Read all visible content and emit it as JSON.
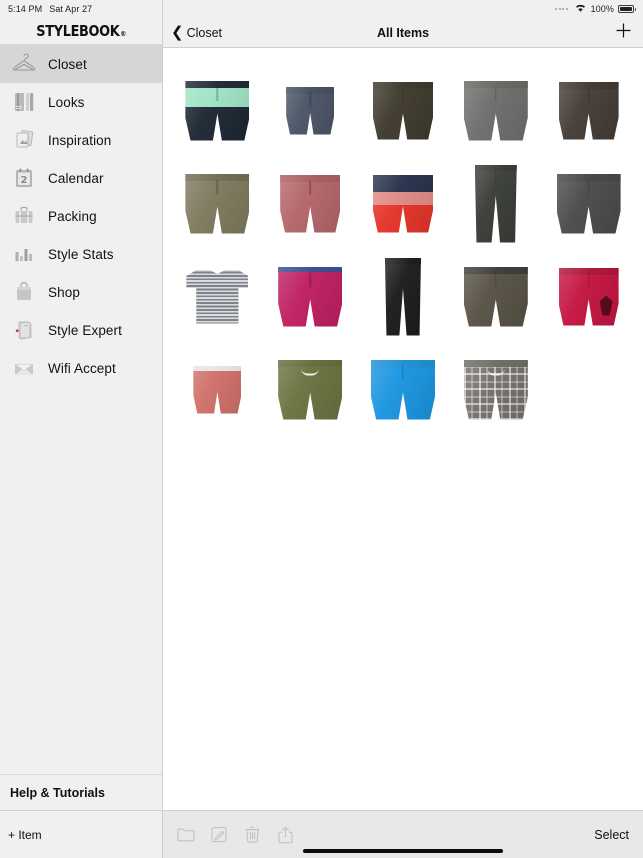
{
  "status_bar": {
    "time": "5:14 PM",
    "date": "Sat Apr 27",
    "battery_percent": "100%",
    "wifi_icon": "wifi-icon",
    "battery_icon": "battery-icon"
  },
  "brand": {
    "name": "STYLEBOOK",
    "registered_mark": "®"
  },
  "sidebar": {
    "items": [
      {
        "label": "Closet",
        "icon": "hanger-icon",
        "selected": true
      },
      {
        "label": "Looks",
        "icon": "outfit-icon",
        "selected": false
      },
      {
        "label": "Inspiration",
        "icon": "photos-icon",
        "selected": false
      },
      {
        "label": "Calendar",
        "icon": "calendar-icon",
        "selected": false
      },
      {
        "label": "Packing",
        "icon": "suitcase-icon",
        "selected": false
      },
      {
        "label": "Style Stats",
        "icon": "bar-chart-icon",
        "selected": false
      },
      {
        "label": "Shop",
        "icon": "shopping-bag-icon",
        "selected": false
      },
      {
        "label": "Style Expert",
        "icon": "book-star-icon",
        "selected": false
      },
      {
        "label": "Wifi Accept",
        "icon": "envelope-icon",
        "selected": false
      }
    ],
    "calendar_day": "2",
    "help_label": "Help & Tutorials",
    "add_item_label": "+ Item"
  },
  "navbar": {
    "back_label": "Closet",
    "back_icon": "chevron-left-icon",
    "title": "All Items",
    "add_icon": "plus-icon"
  },
  "grid": {
    "columns": 5,
    "items": [
      {
        "name": "mint-navy-colorblock-boardshorts",
        "type": "shorts",
        "body": "#9fe3c6",
        "band": "#1d2733",
        "block_bottom": "#1d2733",
        "variant": "wide"
      },
      {
        "name": "navy-chino-shorts",
        "type": "shorts",
        "body": "#4b5566",
        "band": "#434d5d",
        "variant": "narrow"
      },
      {
        "name": "dark-olive-shorts",
        "type": "shorts",
        "body": "#3f3a2d",
        "band": "#3a3529",
        "variant": "normal"
      },
      {
        "name": "grey-chino-shorts",
        "type": "shorts",
        "body": "#6e6e6c",
        "band": "#66665f",
        "variant": "wide"
      },
      {
        "name": "dark-brown-shorts",
        "type": "shorts",
        "body": "#453c36",
        "band": "#3e362f",
        "variant": "normal"
      },
      {
        "name": "khaki-olive-shorts",
        "type": "shorts",
        "body": "#7e7a5e",
        "band": "#6f6b52",
        "variant": "wide"
      },
      {
        "name": "dusty-rose-shorts",
        "type": "shorts",
        "body": "#b5666a",
        "band": "#a85c60",
        "variant": "normal"
      },
      {
        "name": "navy-pink-red-striped-boardshorts",
        "type": "shorts",
        "body": "#e5342a",
        "band": "#27304a",
        "stripe_mid": "#e08b86",
        "variant": "normal"
      },
      {
        "name": "black-trousers",
        "type": "pants",
        "body": "#3a3d38",
        "band": "#34372f"
      },
      {
        "name": "charcoal-cargo-shorts",
        "type": "shorts",
        "body": "#4a4c4c",
        "band": "#434545",
        "variant": "wide"
      },
      {
        "name": "grey-striped-tshirt",
        "type": "tee",
        "body": "#7e838b",
        "stripes": true
      },
      {
        "name": "magenta-boardshorts",
        "type": "shorts",
        "body": "#bf1f62",
        "band": "#3b4a8c",
        "variant": "wide"
      },
      {
        "name": "black-trousers-slim",
        "type": "pants",
        "body": "#1c1c1e",
        "band": "#171718"
      },
      {
        "name": "army-olive-boardshorts",
        "type": "shorts",
        "body": "#575244",
        "band": "#3b3b37",
        "variant": "wide"
      },
      {
        "name": "crimson-logo-boardshorts",
        "type": "shorts",
        "body": "#c41540",
        "band": "#ad1237",
        "logo": true,
        "variant": "normal"
      },
      {
        "name": "salmon-coral-shorts",
        "type": "shorts",
        "body": "#d0706a",
        "band": "#e9e4e0",
        "variant": "narrow"
      },
      {
        "name": "olive-drawstring-shorts",
        "type": "shorts",
        "body": "#6b7340",
        "band": "#636b3a",
        "drawstring": true,
        "variant": "wide"
      },
      {
        "name": "bright-blue-shorts",
        "type": "shorts",
        "body": "#1b95e0",
        "band": "#1b8ed4",
        "variant": "wide"
      },
      {
        "name": "grey-plaid-swim-shorts",
        "type": "shorts",
        "body": "#74706c",
        "band": "#6d6965",
        "plaid": true,
        "drawstring": true,
        "variant": "wide"
      }
    ]
  },
  "toolbar": {
    "icons": [
      {
        "name": "folder-icon",
        "enabled": false
      },
      {
        "name": "edit-icon",
        "enabled": false
      },
      {
        "name": "trash-icon",
        "enabled": false
      },
      {
        "name": "share-icon",
        "enabled": false
      }
    ],
    "select_label": "Select"
  }
}
